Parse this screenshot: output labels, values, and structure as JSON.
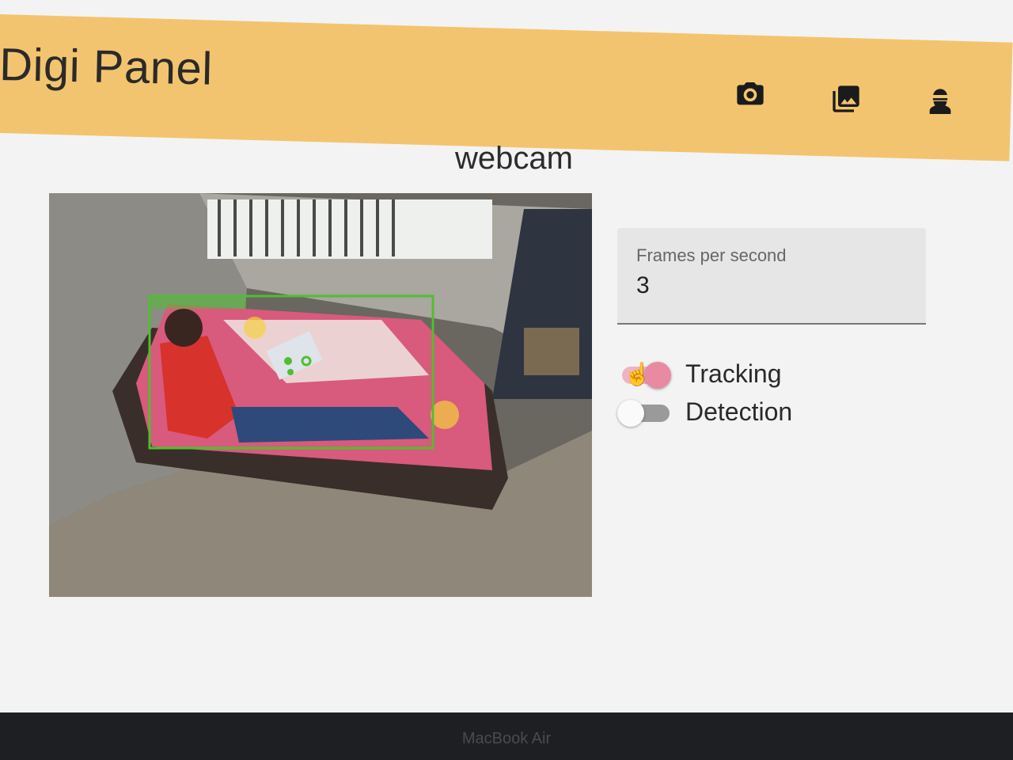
{
  "app": {
    "title": "Digi Panel"
  },
  "toolbar": {
    "icons": [
      "camera-icon",
      "gallery-icon",
      "worker-icon"
    ]
  },
  "page": {
    "title": "webcam"
  },
  "settings": {
    "fps_label": "Frames per second",
    "fps_value": "3",
    "toggles": [
      {
        "label": "Tracking",
        "on": true
      },
      {
        "label": "Detection",
        "on": false
      }
    ]
  },
  "device": {
    "brand": "MacBook Air"
  },
  "colors": {
    "topbar": "#f3c46f",
    "toggle_on": "#e98aa3",
    "toggle_off": "#9a9a9a",
    "detection_box": "#4fbf2f"
  }
}
